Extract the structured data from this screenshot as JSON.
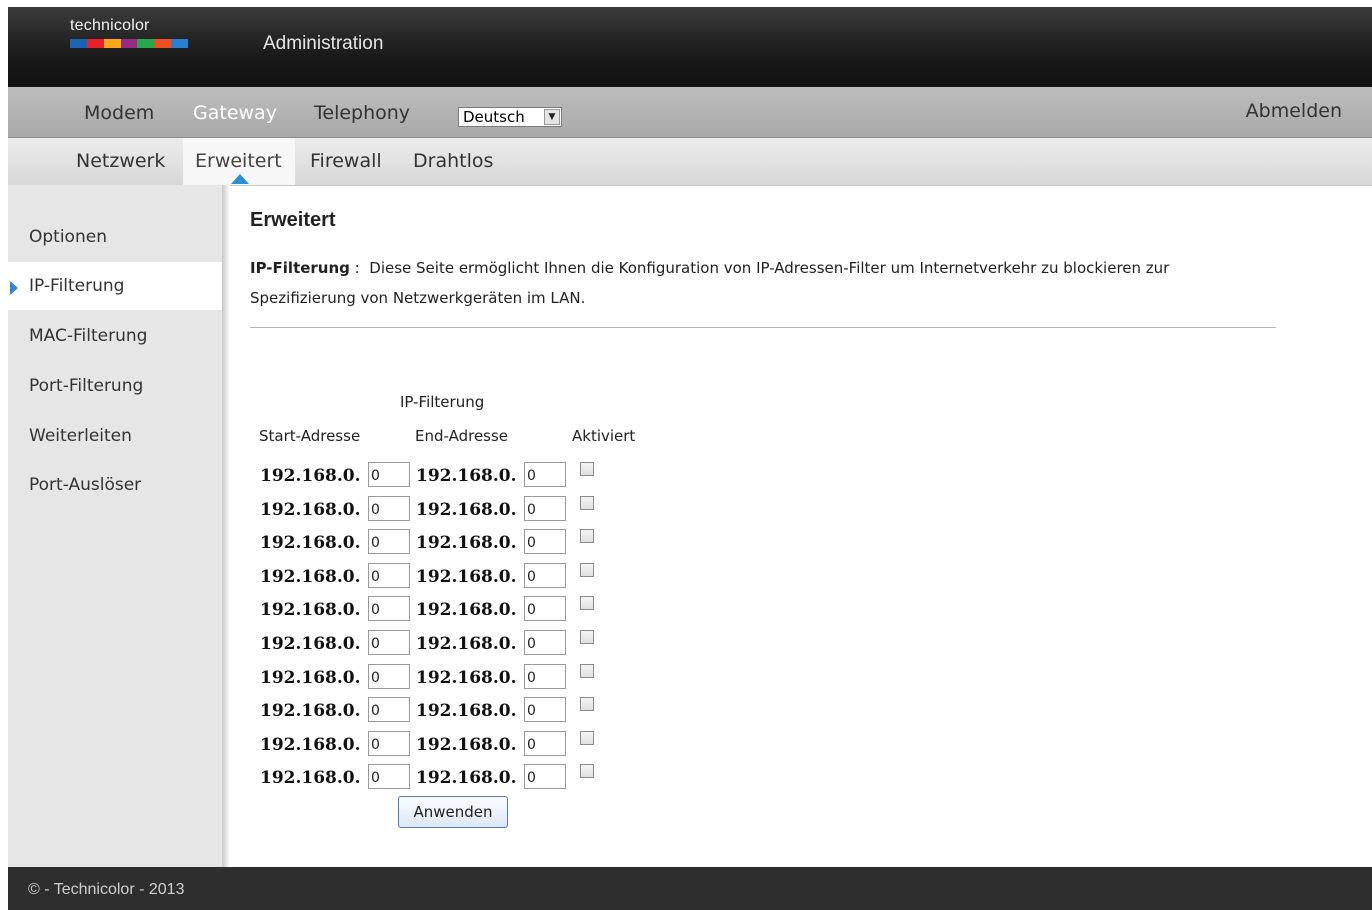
{
  "header": {
    "brand": "technicolor",
    "title": "Administration",
    "logo_colors": [
      "#1a63b5",
      "#e8202a",
      "#f7a81b",
      "#9a2a8a",
      "#27a84a",
      "#f04e23",
      "#2a7fd0"
    ]
  },
  "main_nav": {
    "items": [
      "Modem",
      "Gateway",
      "Telephony"
    ],
    "active": "Gateway",
    "language": "Deutsch",
    "logout": "Abmelden"
  },
  "sub_nav": {
    "items": [
      "Netzwerk",
      "Erweitert",
      "Firewall",
      "Drahtlos"
    ],
    "active": "Erweitert"
  },
  "sidebar": {
    "items": [
      "Optionen",
      "IP-Filterung",
      "MAC-Filterung",
      "Port-Filterung",
      "Weiterleiten",
      "Port-Auslöser"
    ],
    "active": "IP-Filterung"
  },
  "content": {
    "heading": "Erweitert",
    "desc_label": "IP-Filterung",
    "desc_sep": " : ",
    "desc_text": " Diese Seite ermöglicht Ihnen die Konfiguration von IP-Adressen-Filter um Internetverkehr zu blockieren zur Spezifizierung von Netzwerkgeräten im LAN.",
    "table_caption": "IP-Filterung",
    "col_start": "Start-Adresse",
    "col_end": "End-Adresse",
    "col_enabled": "Aktiviert",
    "prefix": "192.168.0.",
    "rows": [
      {
        "start": "0",
        "end": "0",
        "enabled": false
      },
      {
        "start": "0",
        "end": "0",
        "enabled": false
      },
      {
        "start": "0",
        "end": "0",
        "enabled": false
      },
      {
        "start": "0",
        "end": "0",
        "enabled": false
      },
      {
        "start": "0",
        "end": "0",
        "enabled": false
      },
      {
        "start": "0",
        "end": "0",
        "enabled": false
      },
      {
        "start": "0",
        "end": "0",
        "enabled": false
      },
      {
        "start": "0",
        "end": "0",
        "enabled": false
      },
      {
        "start": "0",
        "end": "0",
        "enabled": false
      },
      {
        "start": "0",
        "end": "0",
        "enabled": false
      }
    ],
    "apply": "Anwenden"
  },
  "footer": {
    "text": "© - Technicolor - 2013"
  }
}
